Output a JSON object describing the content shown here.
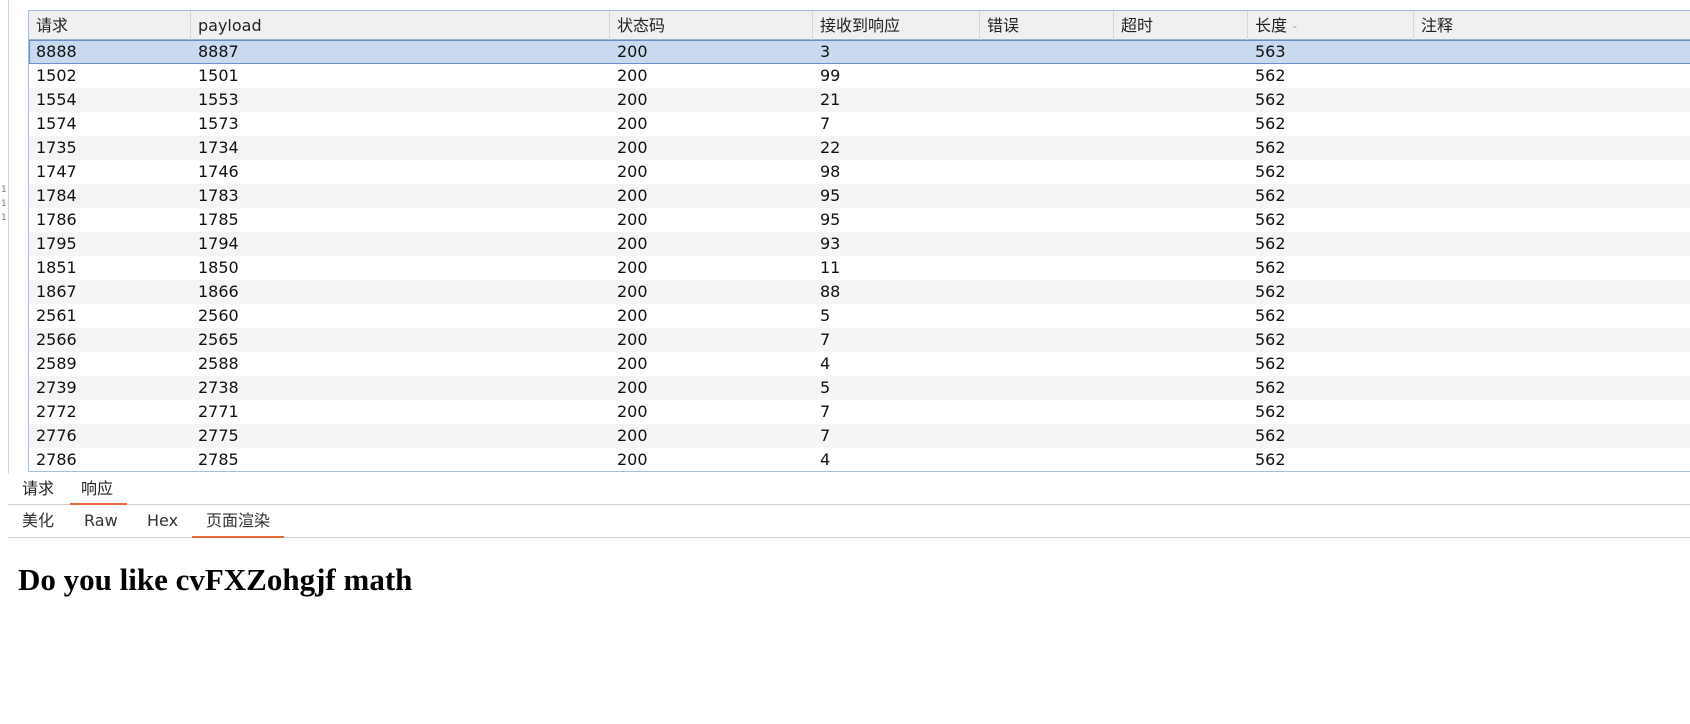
{
  "table": {
    "headers": {
      "request": "请求",
      "payload": "payload",
      "status": "状态码",
      "received": "接收到响应",
      "error": "错误",
      "timeout": "超时",
      "length": "长度",
      "comment": "注释"
    },
    "sort_icon": "chevron-down-icon",
    "rows": [
      {
        "request": "8888",
        "payload": "8887",
        "status": "200",
        "received": "3",
        "error": "",
        "timeout": "",
        "length": "563",
        "comment": ""
      },
      {
        "request": "1502",
        "payload": "1501",
        "status": "200",
        "received": "99",
        "error": "",
        "timeout": "",
        "length": "562",
        "comment": ""
      },
      {
        "request": "1554",
        "payload": "1553",
        "status": "200",
        "received": "21",
        "error": "",
        "timeout": "",
        "length": "562",
        "comment": ""
      },
      {
        "request": "1574",
        "payload": "1573",
        "status": "200",
        "received": "7",
        "error": "",
        "timeout": "",
        "length": "562",
        "comment": ""
      },
      {
        "request": "1735",
        "payload": "1734",
        "status": "200",
        "received": "22",
        "error": "",
        "timeout": "",
        "length": "562",
        "comment": ""
      },
      {
        "request": "1747",
        "payload": "1746",
        "status": "200",
        "received": "98",
        "error": "",
        "timeout": "",
        "length": "562",
        "comment": ""
      },
      {
        "request": "1784",
        "payload": "1783",
        "status": "200",
        "received": "95",
        "error": "",
        "timeout": "",
        "length": "562",
        "comment": ""
      },
      {
        "request": "1786",
        "payload": "1785",
        "status": "200",
        "received": "95",
        "error": "",
        "timeout": "",
        "length": "562",
        "comment": ""
      },
      {
        "request": "1795",
        "payload": "1794",
        "status": "200",
        "received": "93",
        "error": "",
        "timeout": "",
        "length": "562",
        "comment": ""
      },
      {
        "request": "1851",
        "payload": "1850",
        "status": "200",
        "received": "11",
        "error": "",
        "timeout": "",
        "length": "562",
        "comment": ""
      },
      {
        "request": "1867",
        "payload": "1866",
        "status": "200",
        "received": "88",
        "error": "",
        "timeout": "",
        "length": "562",
        "comment": ""
      },
      {
        "request": "2561",
        "payload": "2560",
        "status": "200",
        "received": "5",
        "error": "",
        "timeout": "",
        "length": "562",
        "comment": ""
      },
      {
        "request": "2566",
        "payload": "2565",
        "status": "200",
        "received": "7",
        "error": "",
        "timeout": "",
        "length": "562",
        "comment": ""
      },
      {
        "request": "2589",
        "payload": "2588",
        "status": "200",
        "received": "4",
        "error": "",
        "timeout": "",
        "length": "562",
        "comment": ""
      },
      {
        "request": "2739",
        "payload": "2738",
        "status": "200",
        "received": "5",
        "error": "",
        "timeout": "",
        "length": "562",
        "comment": ""
      },
      {
        "request": "2772",
        "payload": "2771",
        "status": "200",
        "received": "7",
        "error": "",
        "timeout": "",
        "length": "562",
        "comment": ""
      },
      {
        "request": "2776",
        "payload": "2775",
        "status": "200",
        "received": "7",
        "error": "",
        "timeout": "",
        "length": "562",
        "comment": ""
      },
      {
        "request": "2786",
        "payload": "2785",
        "status": "200",
        "received": "4",
        "error": "",
        "timeout": "",
        "length": "562",
        "comment": ""
      }
    ]
  },
  "message_tabs": {
    "request": "请求",
    "response": "响应"
  },
  "view_tabs": {
    "pretty": "美化",
    "raw": "Raw",
    "hex": "Hex",
    "render": "页面渲染"
  },
  "render": {
    "heading": "Do you like cvFXZohgjf math"
  },
  "colors": {
    "accent": "#e8683a",
    "selected_row": "#c9d9ef",
    "header_bg": "#f0f0f0"
  }
}
